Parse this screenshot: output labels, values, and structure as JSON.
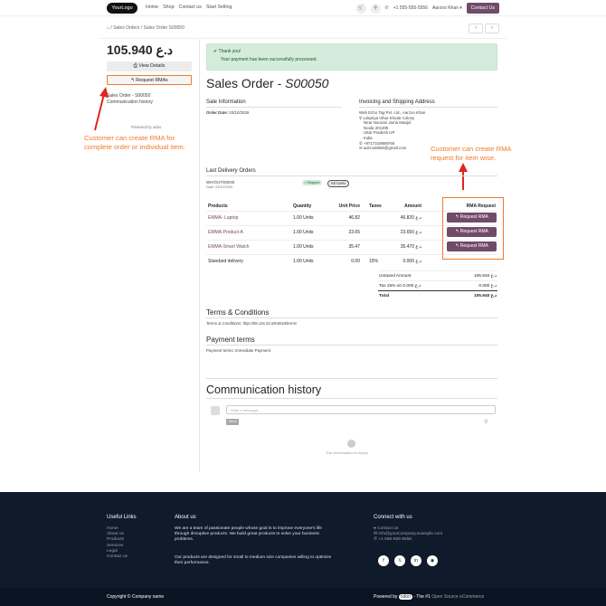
{
  "header": {
    "logo": "YourLogo",
    "nav": [
      "Home",
      "Shop",
      "Contact us",
      "Start Selling"
    ],
    "phone": "+1 555-555-5556",
    "user": "Aarzoo Khan",
    "contact_btn": "Contact Us"
  },
  "breadcrumb": "/ Sales Orders / Sales Order S00050",
  "sidebar": {
    "amount": "105.940 د.ع",
    "view_details": "View Details",
    "request_rmas": "Request RMAs",
    "link1": "Sales Order - S00050",
    "link2": "Communication history",
    "powered": "Powered by odoo"
  },
  "annotations": {
    "left": [
      "Customer can create RMA for",
      "complete order or individual item."
    ],
    "right": [
      "Customer can create RMA",
      "request for item wise."
    ]
  },
  "alert": {
    "title": "Thank you!",
    "body": "Your payment has been successfully processed."
  },
  "order_title": "Sales Order - ",
  "order_number": "S00050",
  "sale_info": {
    "heading": "Sale Information",
    "date_label": "Order Date:",
    "date": "03/10/2026"
  },
  "address": {
    "heading": "Invoicing and Shipping Address",
    "lines": [
      "Web Echo Tag Pvt. Ltd., Aarzoo Khan",
      "Lokpriya Vihar Khoda Colony",
      "Near Noorani Jama Masjid",
      "Noida 201309",
      "Uttar Pradesh UP",
      "India",
      "+9717319898766",
      "aarzook828@gmail.com"
    ]
  },
  "delivery": {
    "heading": "Last Delivery Orders",
    "ref": "WH/OUT/00030",
    "date": "Date: 03/10/2026",
    "shipped": "Shipped",
    "return": "RETURN"
  },
  "table": {
    "headers": [
      "Products",
      "Quantity",
      "Unit Price",
      "Taxes",
      "Amount",
      "RMA Request"
    ],
    "rows": [
      {
        "product": "EMMA- Laptop",
        "qty": "1.00 Units",
        "price": "46.82",
        "tax": "",
        "amount": "46.820 د.ع",
        "rma": "Request RMA"
      },
      {
        "product": "EMMA-Product-A",
        "qty": "1.00 Units",
        "price": "23.65",
        "tax": "",
        "amount": "23.650 د.ع",
        "rma": "Request RMA"
      },
      {
        "product": "EMMA-Smart Watch",
        "qty": "1.00 Units",
        "price": "35.47",
        "tax": "",
        "amount": "35.470 د.ع",
        "rma": "Request RMA"
      },
      {
        "product": "Standard delivery",
        "qty": "1.00 Units",
        "price": "0.00",
        "tax": "15%",
        "amount": "0.000 د.ع",
        "rma": ""
      }
    ]
  },
  "totals": [
    {
      "label": "Untaxed Amount",
      "value": "105.940 د.ع"
    },
    {
      "label": "Tax 15% on 0.000 د.ع",
      "value": "0.000 د.ع"
    },
    {
      "label": "Total",
      "value": "105.940 د.ع"
    }
  ],
  "terms": {
    "heading": "Terms & Conditions",
    "text": "Terms & Conditions: http://89.116.32.68:8018/terms"
  },
  "payment": {
    "heading": "Payment terms",
    "text": "Payment terms: Immediate Payment"
  },
  "communication": {
    "heading": "Communication history",
    "placeholder": "Write a message...",
    "send": "Send",
    "empty": "The conversation is empty."
  },
  "footer": {
    "useful_links": {
      "heading": "Useful Links",
      "items": [
        "Home",
        "About us",
        "Products",
        "Services",
        "Legal",
        "Contact us"
      ]
    },
    "about": {
      "heading": "About us",
      "p1": "We are a team of passionate people whose goal is to improve everyone's life through disruptive products. We build great products to solve your business problems.",
      "p2": "Our products are designed for small to medium size companies willing to optimize their performance."
    },
    "connect": {
      "heading": "Connect with us",
      "items": [
        "Contact us",
        "info@yourcompany.example.com",
        "+1 555-555-5556"
      ]
    },
    "copyright": "Copyright © Company name",
    "powered_prefix": "Powered by",
    "powered_brand": "odoo",
    "powered_suffix": " - The #1 ",
    "powered_link": "Open Source eCommerce"
  }
}
